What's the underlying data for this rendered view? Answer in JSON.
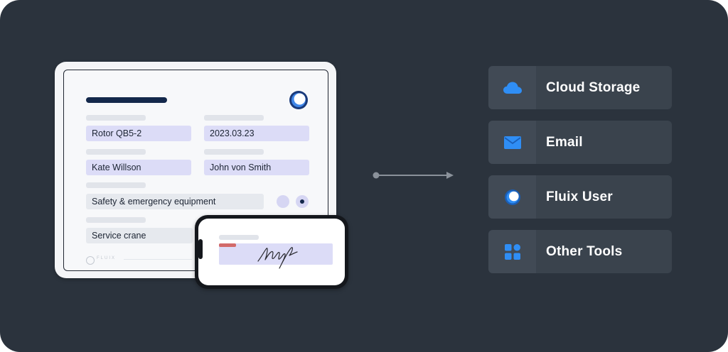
{
  "form": {
    "field_1": "Rotor QB5-2",
    "field_2": "2023.03.23",
    "field_3": "Kate Willson",
    "field_4": "John von Smith",
    "field_5": "Safety & emergency equipment",
    "field_6": "Service crane",
    "footer_brand": "FLUIX",
    "radio_selected": 2
  },
  "destinations": [
    {
      "label": "Cloud Storage",
      "icon": "cloud-icon"
    },
    {
      "label": "Email",
      "icon": "envelope-icon"
    },
    {
      "label": "Fluix User",
      "icon": "fluix-logo-icon"
    },
    {
      "label": "Other Tools",
      "icon": "grid-apps-icon"
    }
  ],
  "colors": {
    "background": "#2b333d",
    "card": "#3a434d",
    "icon_blue": "#2f8ef5",
    "navy": "#14284b",
    "field_highlight": "#dcdcf7"
  }
}
